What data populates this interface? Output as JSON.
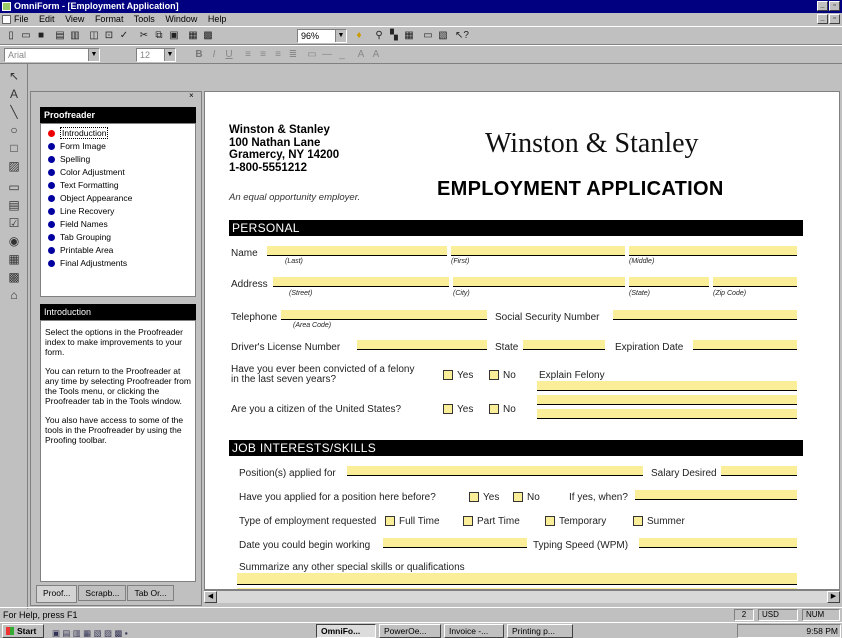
{
  "window": {
    "title": "OmniForm - [Employment Application]",
    "min": "_",
    "restore": "▫",
    "close": "×"
  },
  "menu": [
    "File",
    "Edit",
    "View",
    "Format",
    "Tools",
    "Window",
    "Help"
  ],
  "toolbar": {
    "zoom": "96%",
    "font": "Arial",
    "size": "12"
  },
  "proofreader": {
    "title": "Proofreader",
    "items": [
      "Introduction",
      "Form Image",
      "Spelling",
      "Color Adjustment",
      "Text Formatting",
      "Object Appearance",
      "Line Recovery",
      "Field Names",
      "Tab Grouping",
      "Printable Area",
      "Final Adjustments"
    ],
    "intro_title": "Introduction",
    "intro_paragraphs": [
      "Select the options in the Proofreader index to make improvements to your form.",
      "You can return to the Proofreader at any time by selecting Proofreader from the Tools menu, or clicking the Proofreader tab in the Tools window.",
      "You also have access to some of the tools in the Proofreader by using the Proofing toolbar."
    ],
    "tabs": [
      "Proof...",
      "Scrapb...",
      "Tab Or..."
    ]
  },
  "form": {
    "address_lines": [
      "Winston & Stanley",
      "100 Nathan Lane",
      "Gramercy, NY 14200",
      "1-800-5551212"
    ],
    "eoe": "An equal opportunity employer.",
    "brand": "Winston & Stanley",
    "title": "EMPLOYMENT APPLICATION",
    "sec_personal": "PERSONAL",
    "name": "Name",
    "last": "(Last)",
    "first": "(First)",
    "middle": "(Middle)",
    "address": "Address",
    "street": "(Street)",
    "city": "(City)",
    "state_sub": "(State)",
    "zip": "(Zip Code)",
    "telephone": "Telephone",
    "area_code": "(Area Code)",
    "ssn": "Social Security Number",
    "license": "Driver's License Number",
    "state": "State",
    "expiration": "Expiration Date",
    "felony_q1": "Have you ever been convicted of a felony",
    "felony_q2": "in the last seven years?",
    "yes": "Yes",
    "no": "No",
    "explain": "Explain Felony",
    "citizen_q": "Are you a citizen of the United States?",
    "sec_job": "JOB INTERESTS/SKILLS",
    "position": "Position(s) applied for",
    "salary": "Salary Desired",
    "applied_before": "Have you applied for a position here before?",
    "if_yes": "If yes, when?",
    "emp_type": "Type of employment requested",
    "full_time": "Full Time",
    "part_time": "Part Time",
    "temporary": "Temporary",
    "summer": "Summer",
    "begin": "Date you could begin working",
    "typing": "Typing Speed (WPM)",
    "summarize": "Summarize any other special skills or qualifications"
  },
  "status": {
    "help": "For Help, press F1",
    "page": "2",
    "units": "USD",
    "num": "NUM"
  },
  "taskbar": {
    "start": "Start",
    "items": [
      "OmniFo...",
      "PowerOe...",
      "Invoice -...",
      "Printing p..."
    ],
    "clock": "9:58 PM"
  }
}
